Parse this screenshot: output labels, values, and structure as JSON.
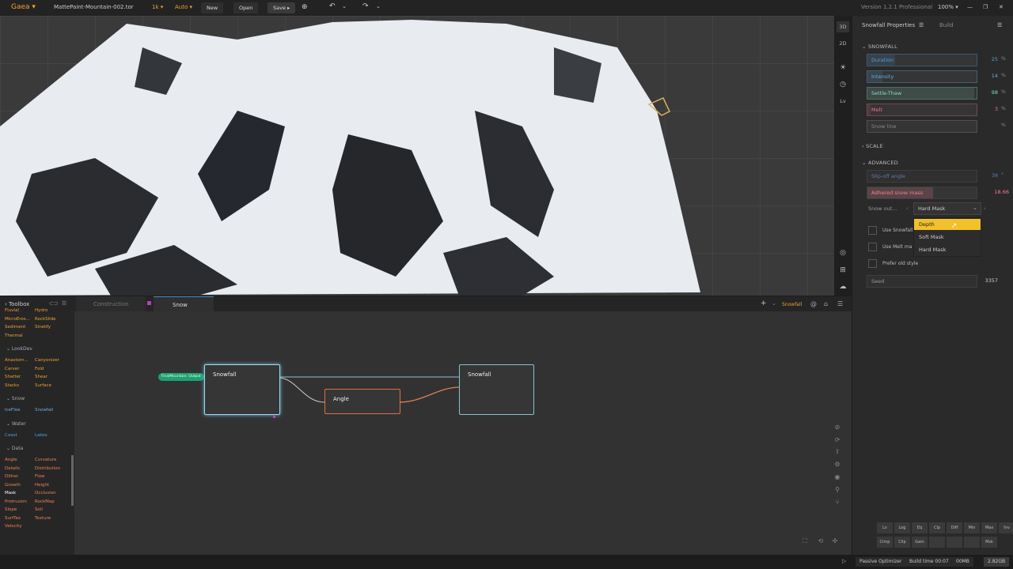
{
  "topbar": {
    "app_menu": "Gaea ▾",
    "file_name": "MattePaint-Mountain-002.tor",
    "resolution": "1k ▾",
    "auto": "Auto ▾",
    "new": "New",
    "open": "Open",
    "save": "Save ▸",
    "version": "Version 1.2.1 Professional",
    "zoom": "100% ▾"
  },
  "viewport_tools": [
    "3D",
    "2D",
    "Lv"
  ],
  "panel": {
    "tab_properties": "Snowfall Properties",
    "tab_build": "Build",
    "section_snowfall": "SNOWFALL",
    "section_scale": "SCALE",
    "section_advanced": "ADVANCED",
    "sliders": [
      {
        "label": "Duration",
        "value": "25",
        "unit": "%",
        "fraction": 0.25,
        "color": "#4aa0e0"
      },
      {
        "label": "Intensity",
        "value": "14",
        "unit": "%",
        "fraction": 0.14,
        "color": "#5ab0f0"
      },
      {
        "label": "Settle-Thaw",
        "value": "98",
        "unit": "%",
        "fraction": 0.98,
        "color": "#7fe0c0"
      },
      {
        "label": "Melt",
        "value": "3",
        "unit": "%",
        "fraction": 0.03,
        "color": "#f07090"
      },
      {
        "label": "Snow line",
        "value": "",
        "unit": "%",
        "fraction": 0.0,
        "color": "#888888"
      }
    ],
    "slip_off": {
      "label": "Slip-off angle",
      "value": "38",
      "unit": "°",
      "color": "#5a7ab0"
    },
    "adhered": {
      "label": "Adhered snow mass",
      "value": "18.66",
      "fraction": 0.6,
      "color": "#f08090"
    },
    "snow_out_label": "Snow out...",
    "snow_out_value": "Hard Mask",
    "dropdown_options": [
      "Depth",
      "Soft Mask",
      "Hard Mask"
    ],
    "checks": [
      "Use Snowfall",
      "Use Melt ma",
      "Prefer old style"
    ],
    "seed_label": "Seed",
    "seed_value": "3357"
  },
  "graph_header": {
    "toolbox": "Toolbox",
    "tab_construction": "Construction",
    "tab_snow": "Snow",
    "current_node": "Snowfall"
  },
  "toolbox": {
    "top_items": [
      [
        "Fluvial",
        "Hydro"
      ],
      [
        "MicroEros...",
        "RockSlide"
      ],
      [
        "Sediment",
        "Stratify"
      ],
      [
        "Thermal",
        ""
      ]
    ],
    "groups": [
      {
        "name": "LookDev",
        "items": [
          [
            "Anastom...",
            "Canyonizer"
          ],
          [
            "Carver",
            "Fold"
          ],
          [
            "Shatter",
            "Shear"
          ],
          [
            "Stacks",
            "Surface"
          ]
        ],
        "color": "#f0a030"
      },
      {
        "name": "Snow",
        "items": [
          [
            "IceFloe",
            "Snowfall"
          ]
        ],
        "color": "#6ab0f0"
      },
      {
        "name": "Water",
        "items": [
          [
            "Coast",
            "Lakes"
          ]
        ],
        "color": "#4aa0f0"
      },
      {
        "name": "Data",
        "items": [
          [
            "Angle",
            "Curvature"
          ],
          [
            "Details",
            "Distribution"
          ],
          [
            "Dither",
            "Flow"
          ],
          [
            "Growth",
            "Height"
          ],
          [
            "Mask",
            "Occlusion"
          ],
          [
            "Protrusion",
            "RockMap"
          ],
          [
            "Slope",
            "Soil"
          ],
          [
            "SurfTex",
            "Texture"
          ],
          [
            "Velocity",
            ""
          ]
        ],
        "color": "#f08050"
      }
    ]
  },
  "nodes": {
    "input_port": "FinalMountain: Output",
    "n1": "Snowfall",
    "n2": "Angle",
    "n3": "Snowfall"
  },
  "bottom_buttons": {
    "row1": [
      "Lv",
      "Log",
      "Eq",
      "Clp",
      "Diff",
      "Min",
      "Max",
      "Inv"
    ],
    "row2": [
      "Clmp",
      "Clip",
      "Gain",
      "",
      "",
      "",
      "Msk"
    ]
  },
  "status": {
    "optimizer": "Passive Optimizer",
    "build_time": "Build time 00:07",
    "mem": "00MB",
    "size": "2.82GB"
  }
}
